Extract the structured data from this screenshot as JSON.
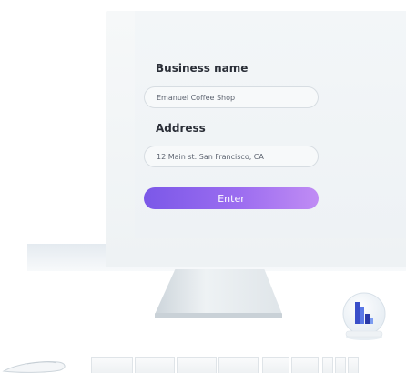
{
  "form": {
    "business_name_label": "Business name",
    "business_name_value": "Emanuel Coffee Shop",
    "address_label": "Address",
    "address_value": "12 Main st. San Francisco, CA",
    "enter_label": "Enter"
  },
  "colors": {
    "button_start": "#7b58e8",
    "button_end": "#c08cf4",
    "label_text": "#2b2f38"
  },
  "icons": {
    "globe": "bar-chart-globe-icon",
    "mouse": "mouse-icon",
    "keyboard": "keyboard-icon"
  }
}
